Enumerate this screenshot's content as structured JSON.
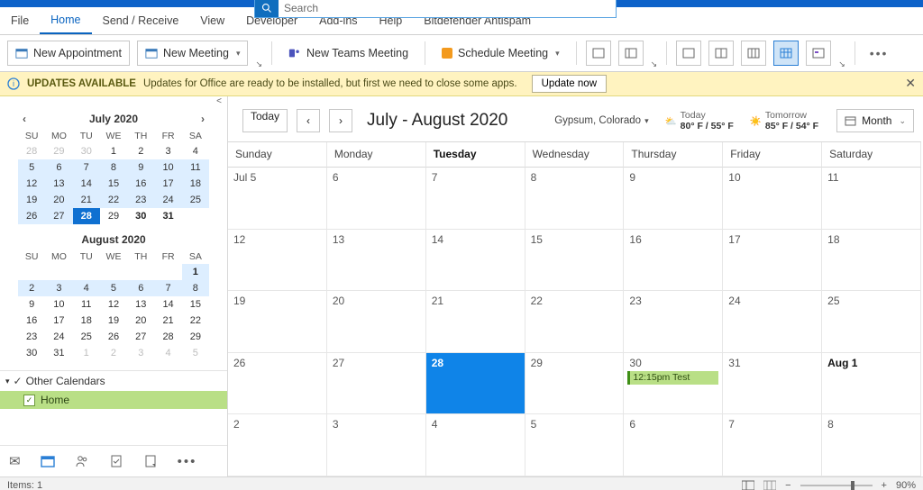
{
  "search": {
    "placeholder": "Search"
  },
  "tabs": [
    "File",
    "Home",
    "Send / Receive",
    "View",
    "Developer",
    "Add-ins",
    "Help",
    "Bitdefender Antispam"
  ],
  "ribbon": {
    "new_appointment": "New Appointment",
    "new_meeting": "New Meeting",
    "new_teams_meeting": "New Teams Meeting",
    "schedule_meeting": "Schedule Meeting"
  },
  "notice": {
    "title": "UPDATES AVAILABLE",
    "msg": "Updates for Office are ready to be installed, but first we need to close some apps.",
    "btn": "Update now"
  },
  "mini": {
    "month1": "July 2020",
    "month2": "August 2020",
    "dow": [
      "SU",
      "MO",
      "TU",
      "WE",
      "TH",
      "FR",
      "SA"
    ]
  },
  "other_calendars": {
    "header": "Other Calendars",
    "item": "Home"
  },
  "main": {
    "today_btn": "Today",
    "range": "July - August 2020",
    "location": "Gypsum, Colorado",
    "wx_today_label": "Today",
    "wx_today_temp": "80° F / 55° F",
    "wx_tom_label": "Tomorrow",
    "wx_tom_temp": "85° F / 54° F",
    "month_btn": "Month"
  },
  "grid": {
    "headers": [
      "Sunday",
      "Monday",
      "Tuesday",
      "Wednesday",
      "Thursday",
      "Friday",
      "Saturday"
    ],
    "rows": [
      [
        "Jul 5",
        "6",
        "7",
        "8",
        "9",
        "10",
        "11"
      ],
      [
        "12",
        "13",
        "14",
        "15",
        "16",
        "17",
        "18"
      ],
      [
        "19",
        "20",
        "21",
        "22",
        "23",
        "24",
        "25"
      ],
      [
        "26",
        "27",
        "28",
        "29",
        "30",
        "31",
        "Aug 1"
      ],
      [
        "2",
        "3",
        "4",
        "5",
        "6",
        "7",
        "8"
      ]
    ],
    "event": {
      "row": 3,
      "col": 4,
      "text": "12:15pm Test"
    }
  },
  "status": {
    "items_label": "Items: 1",
    "zoom": "90%"
  }
}
